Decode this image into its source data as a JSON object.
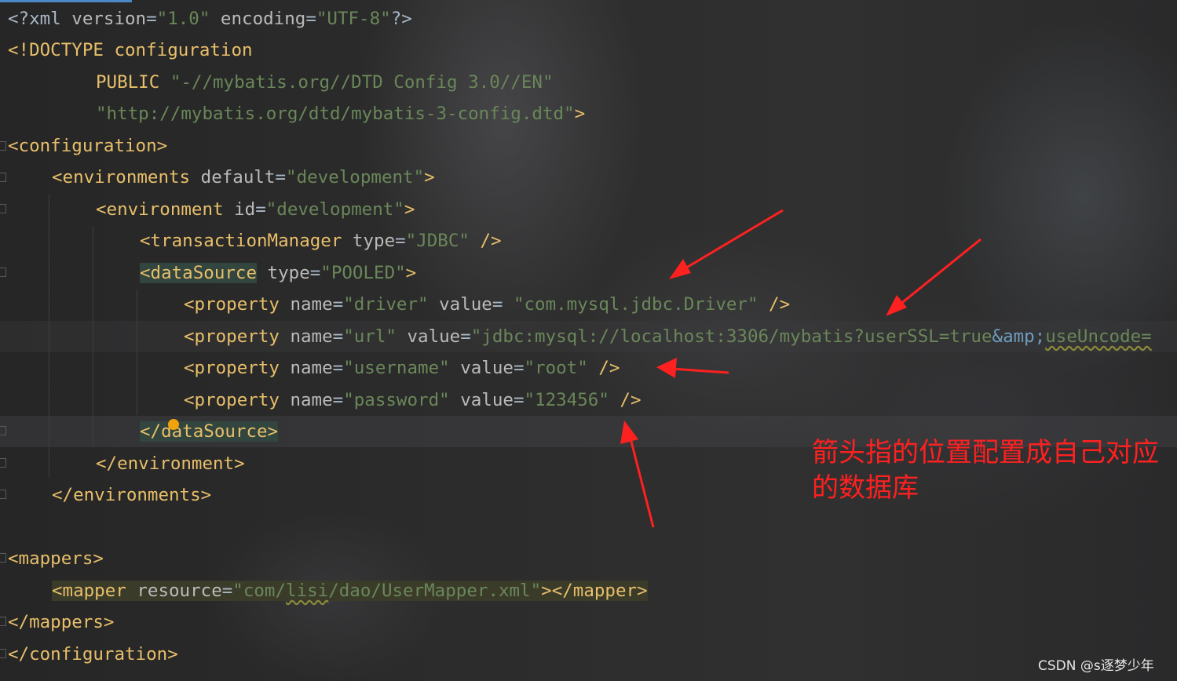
{
  "editor": {
    "lines": [
      {
        "segments": [
          "<?xml",
          " version",
          "=",
          "\"1.0\"",
          " encoding",
          "=",
          "\"UTF-8\"",
          "?>"
        ]
      },
      {
        "segments": [
          "<!DOCTYPE configuration"
        ]
      },
      {
        "segments": [
          "PUBLIC ",
          "\"-//mybatis.org//DTD Config 3.0//EN\""
        ]
      },
      {
        "segments": [
          "\"http://mybatis.org/dtd/mybatis-3-config.dtd\"",
          ">"
        ]
      },
      {
        "segments": [
          "<configuration>"
        ]
      },
      {
        "segments": [
          "<environments",
          " default",
          "=",
          "\"development\"",
          ">"
        ]
      },
      {
        "segments": [
          "<environment",
          " id",
          "=",
          "\"development\"",
          ">"
        ]
      },
      {
        "segments": [
          "<transactionManager",
          " type",
          "=",
          "\"JDBC\"",
          " />"
        ]
      },
      {
        "segments": [
          "<dataSource",
          " type",
          "=",
          "\"POOLED\"",
          ">"
        ]
      },
      {
        "segments": [
          "<property",
          " name",
          "=",
          "\"driver\"",
          " value",
          "= ",
          "\"com.mysql.jdbc.Driver\"",
          " />"
        ]
      },
      {
        "segments": [
          "<property",
          " name",
          "=",
          "\"url\"",
          " value",
          "=",
          "\"jdbc:mysql://localhost:3306/mybatis?userSSL=true",
          "&amp;",
          "useUncode="
        ]
      },
      {
        "segments": [
          "<property",
          " name",
          "=",
          "\"username\"",
          " value",
          "=",
          "\"root\"",
          " />"
        ]
      },
      {
        "segments": [
          "<property",
          " name",
          "=",
          "\"password\"",
          " value",
          "=",
          "\"123456\"",
          " />"
        ]
      },
      {
        "segments": [
          "</dataSource>"
        ]
      },
      {
        "segments": [
          "</environment>"
        ]
      },
      {
        "segments": [
          "</environments>"
        ]
      },
      {
        "segments": [
          ""
        ]
      },
      {
        "segments": [
          "<mappers>"
        ]
      },
      {
        "segments": [
          "<mapper",
          " resource",
          "=",
          "\"com/",
          "lisi",
          "/dao/UserMapper.xml\"",
          "></mapper>"
        ]
      },
      {
        "segments": [
          "</mappers>"
        ]
      },
      {
        "segments": [
          "</configuration>"
        ]
      }
    ]
  },
  "annotation": {
    "text": "箭头指的位置配置成自己对应的数据库",
    "color": "#ff2020"
  },
  "watermark": {
    "text": "CSDN @s逐梦少年"
  },
  "colors": {
    "tag": "#e8bf6a",
    "attribute": "#bababa",
    "string": "#6a8759",
    "keyword": "#cc7832",
    "entity": "#6d9cbe",
    "arrow": "#ff2020",
    "background": "#2b2b2b"
  }
}
